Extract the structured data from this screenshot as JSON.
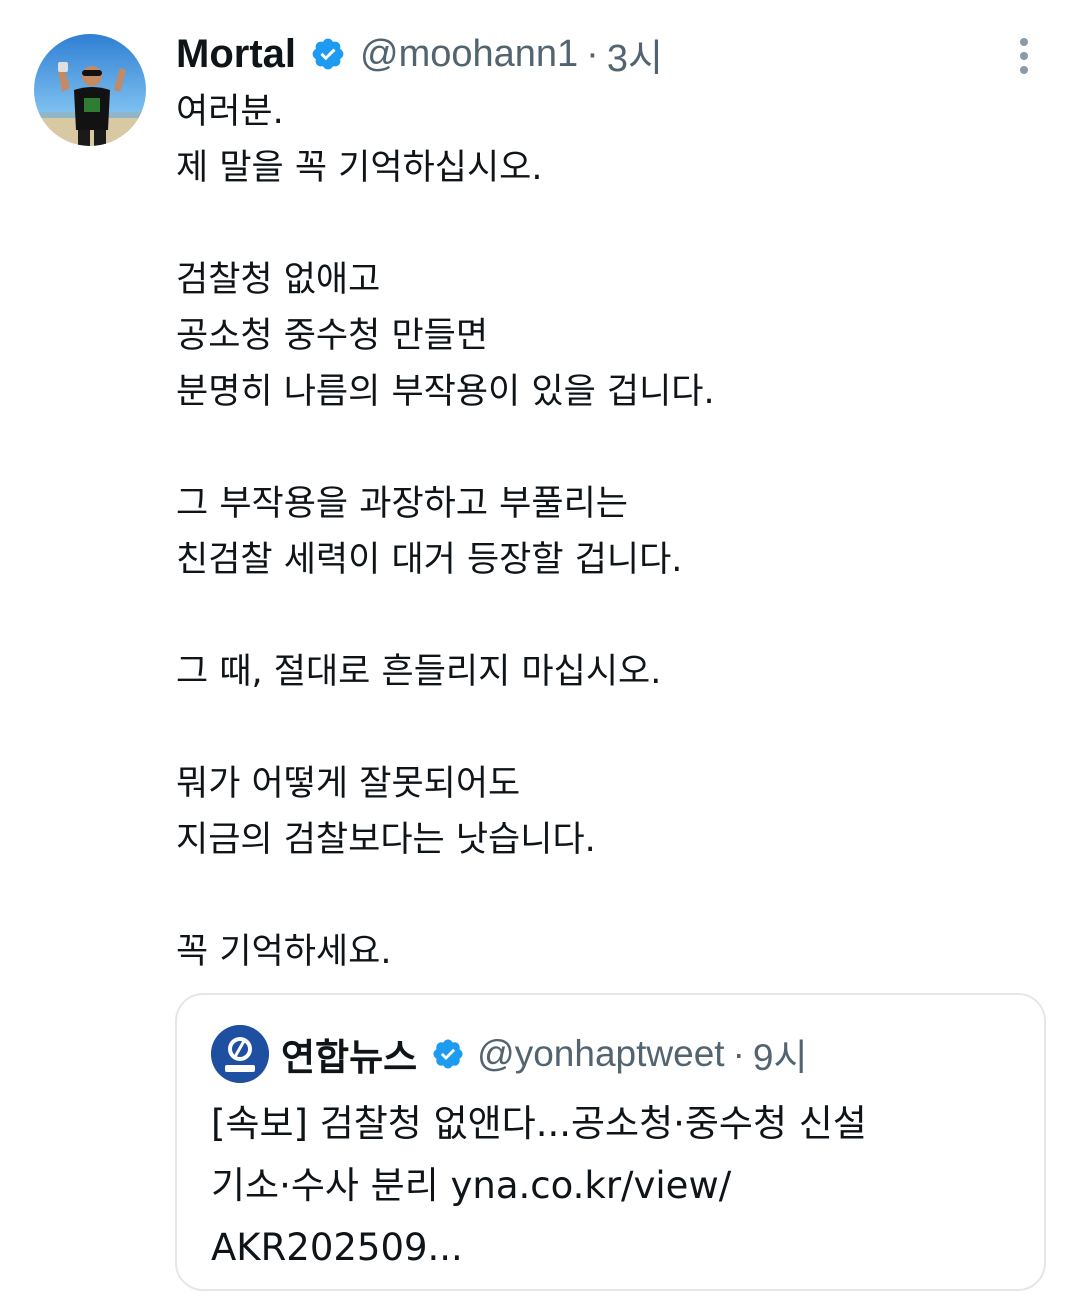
{
  "tweet": {
    "author_name": "Mortal",
    "handle": "@moohann1",
    "separator": "·",
    "time": "3시",
    "verified_icon": "verified-badge-icon",
    "more_icon": "more-vertical-icon",
    "accent_color": "#1d9bf0",
    "lines": [
      "여러분.",
      "제 말을 꼭 기억하십시오.",
      "",
      "검찰청 없애고",
      "공소청 중수청 만들면",
      "분명히 나름의 부작용이 있을 겁니다.",
      "",
      "그 부작용을 과장하고 부풀리는",
      "친검찰 세력이 대거 등장할 겁니다.",
      "",
      "그 때, 절대로 흔들리지 마십시오.",
      "",
      "뭐가 어떻게 잘못되어도",
      "지금의 검찰보다는 낫습니다.",
      "",
      "꼭 기억하세요."
    ]
  },
  "quoted_tweet": {
    "author_name": "연합뉴스",
    "handle": "@yonhaptweet",
    "separator": "·",
    "time": "9시",
    "avatar_icon": "yonhap-logo-icon",
    "lines": [
      "[속보] 검찰청 없앤다...공소청·중수청 신설",
      "기소·수사 분리 yna.co.kr/view/",
      "AKR202509..."
    ]
  }
}
